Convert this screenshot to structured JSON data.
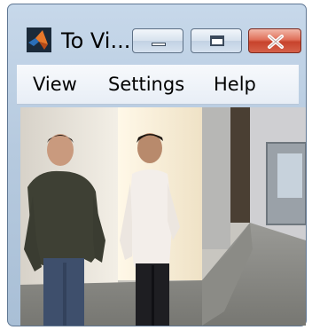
{
  "window": {
    "title": "To Vi..."
  },
  "menu": {
    "items": [
      "View",
      "Settings",
      "Help"
    ]
  },
  "icons": {
    "app": "matlab-icon",
    "minimize": "minimize-icon",
    "maximize": "maximize-icon",
    "close": "close-icon"
  },
  "colors": {
    "close_button": "#d5614a",
    "title_bar": "#b6cadf"
  }
}
